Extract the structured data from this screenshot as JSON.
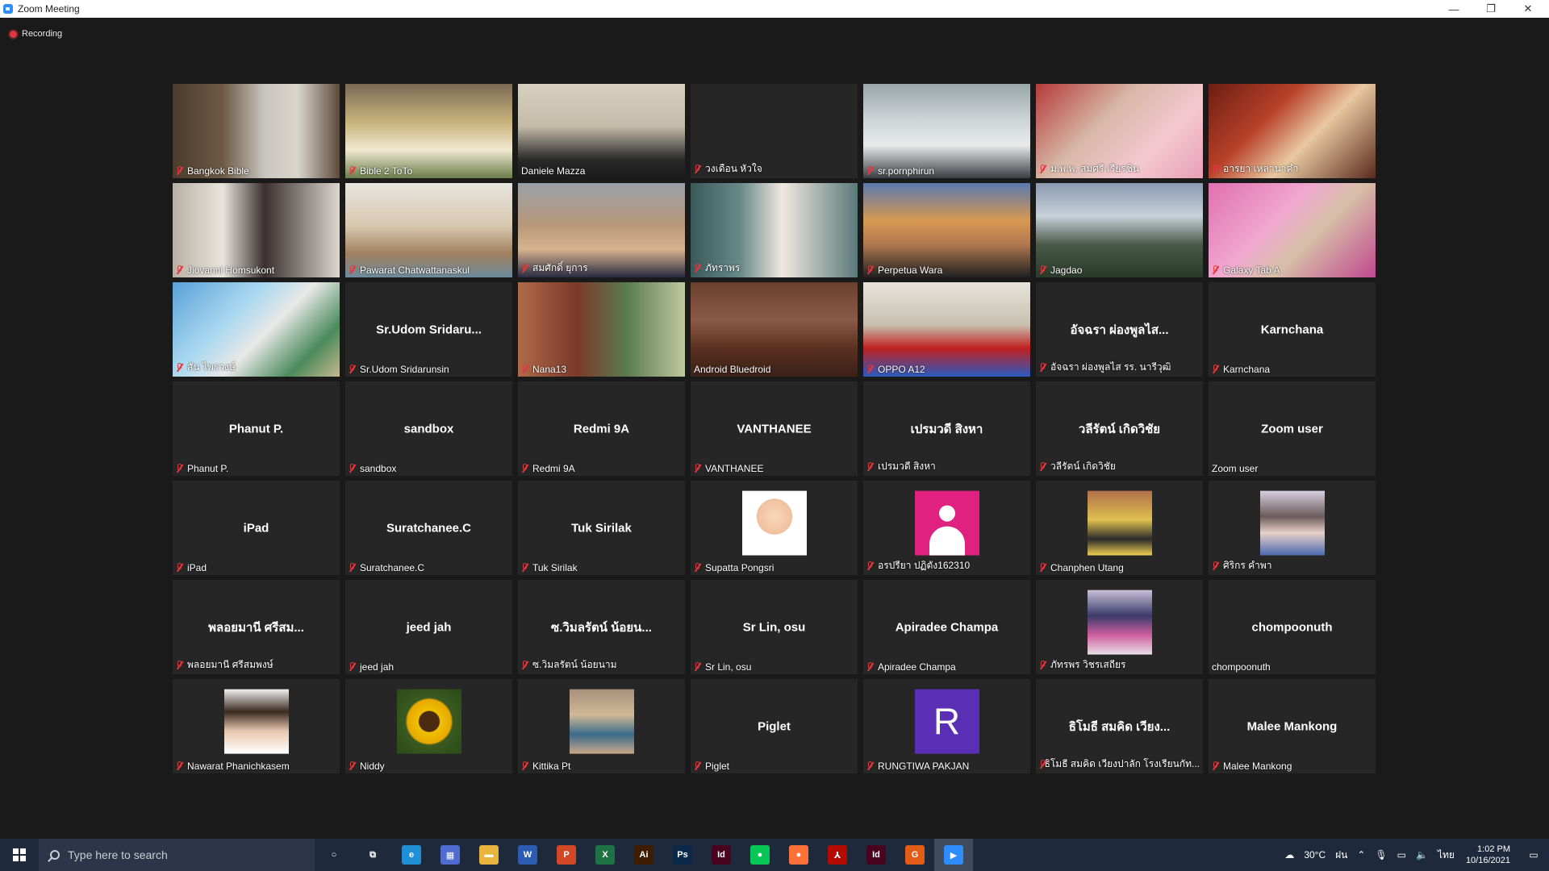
{
  "window": {
    "title": "Zoom Meeting",
    "controls": {
      "minimize": "—",
      "restore": "❐",
      "close": "✕"
    }
  },
  "recording": {
    "label": "Recording"
  },
  "participants": [
    {
      "label": "Bangkok Bible",
      "tile": "",
      "muted": true,
      "video": "p1"
    },
    {
      "label": "Bible 2 ToTo",
      "tile": "",
      "muted": true,
      "video": "p2"
    },
    {
      "label": "Daniele Mazza",
      "tile": "",
      "muted": false,
      "video": "p3",
      "active": true
    },
    {
      "label": "วงเดือน หัวใจ",
      "tile": "",
      "muted": true,
      "video": "dark"
    },
    {
      "label": "sr.pornphirun",
      "tile": "",
      "muted": true,
      "video": "p5"
    },
    {
      "label": "ม.พ.พ. สมศรี เรียรชิน",
      "tile": "",
      "muted": true,
      "video": "p6"
    },
    {
      "label": "อารยา เหลานาคำ",
      "tile": "",
      "muted": true,
      "video": "p7"
    },
    {
      "label": "Jiovanni Homsukont",
      "tile": "",
      "muted": true,
      "video": "p8"
    },
    {
      "label": "Pawarat Chatwattanaskul",
      "tile": "",
      "muted": true,
      "video": "p9"
    },
    {
      "label": "สมศักดิ์ ยุการ",
      "tile": "",
      "muted": true,
      "video": "p10"
    },
    {
      "label": "ภัทราพร",
      "tile": "",
      "muted": true,
      "video": "p11"
    },
    {
      "label": "Perpetua Wara",
      "tile": "",
      "muted": true,
      "video": "p12"
    },
    {
      "label": "Jagdao",
      "tile": "",
      "muted": true,
      "video": "p13"
    },
    {
      "label": "Galaxy Tab A",
      "tile": "",
      "muted": true,
      "video": "p14"
    },
    {
      "label": "สัน ไพรวงษ์",
      "tile": "",
      "muted": true,
      "video": "p15"
    },
    {
      "label": "Sr.Udom Sridarunsin",
      "tile": "Sr.Udom  Sridaru...",
      "muted": true,
      "video": "none"
    },
    {
      "label": "Nana13",
      "tile": "",
      "muted": true,
      "video": "p17"
    },
    {
      "label": "Android Bluedroid",
      "tile": "",
      "muted": false,
      "video": "p18"
    },
    {
      "label": "OPPO A12",
      "tile": "",
      "muted": true,
      "video": "p19"
    },
    {
      "label": "อัจฉรา ผ่องพูลไส รร. นารีวุฒิ",
      "tile": "อัจฉรา ผ่องพูลไส...",
      "muted": true,
      "video": "none"
    },
    {
      "label": "Karnchana",
      "tile": "Karnchana",
      "muted": true,
      "video": "none"
    },
    {
      "label": "Phanut P.",
      "tile": "Phanut P.",
      "muted": true,
      "video": "none"
    },
    {
      "label": "sandbox",
      "tile": "sandbox",
      "muted": true,
      "video": "none"
    },
    {
      "label": "Redmi 9A",
      "tile": "Redmi 9A",
      "muted": true,
      "video": "none"
    },
    {
      "label": "VANTHANEE",
      "tile": "VANTHANEE",
      "muted": true,
      "video": "none"
    },
    {
      "label": "เปรมวดี สิงหา",
      "tile": "เปรมวดี สิงหา",
      "muted": true,
      "video": "none"
    },
    {
      "label": "วลีรัตน์ เกิดวิชัย",
      "tile": "วลีรัตน์ เกิดวิชัย",
      "muted": true,
      "video": "none"
    },
    {
      "label": "Zoom user",
      "tile": "Zoom user",
      "muted": false,
      "video": "none"
    },
    {
      "label": "iPad",
      "tile": "iPad",
      "muted": true,
      "video": "none"
    },
    {
      "label": "Suratchanee.C",
      "tile": "Suratchanee.C",
      "muted": true,
      "video": "none"
    },
    {
      "label": "Tuk Sirilak",
      "tile": "Tuk Sirilak",
      "muted": true,
      "video": "none"
    },
    {
      "label": "Supatta Pongsri",
      "tile": "",
      "muted": true,
      "video": "pic-angel"
    },
    {
      "label": "อรปรียา ปฏิตัง162310",
      "tile": "",
      "muted": true,
      "video": "pic-default"
    },
    {
      "label": "Chanphen Utang",
      "tile": "",
      "muted": true,
      "video": "pic-group"
    },
    {
      "label": "ศิริกร คำพา",
      "tile": "",
      "muted": true,
      "video": "pic-kids"
    },
    {
      "label": "พลอยมานี ศรีสมพงษ์",
      "tile": "พลอยมานี ศรีสม...",
      "muted": true,
      "video": "none"
    },
    {
      "label": "jeed jah",
      "tile": "jeed jah",
      "muted": true,
      "video": "none"
    },
    {
      "label": "ซ.วิมลรัตน์ น้อยนาม",
      "tile": "ซ.วิมลรัตน์ น้อยน...",
      "muted": true,
      "video": "none"
    },
    {
      "label": "Sr Lin, osu",
      "tile": "Sr Lin, osu",
      "muted": true,
      "video": "none"
    },
    {
      "label": "Apiradee Champa",
      "tile": "Apiradee Champa",
      "muted": true,
      "video": "none"
    },
    {
      "label": "ภัทรพร วิชรเสถียร",
      "tile": "",
      "muted": true,
      "video": "pic-flowers"
    },
    {
      "label": "chompoonuth",
      "tile": "chompoonuth",
      "muted": false,
      "video": "none"
    },
    {
      "label": "Nawarat Phanichkasem",
      "tile": "",
      "muted": true,
      "video": "pic-woman"
    },
    {
      "label": "Niddy",
      "tile": "",
      "muted": true,
      "video": "pic-sunflower"
    },
    {
      "label": "Kittika Pt",
      "tile": "",
      "muted": true,
      "video": "pic-girl"
    },
    {
      "label": "Piglet",
      "tile": "Piglet",
      "muted": true,
      "video": "none"
    },
    {
      "label": "RUNGTIWA PAKJAN",
      "tile": "",
      "muted": true,
      "video": "pic-r",
      "initial": "R"
    },
    {
      "label": "ธิโมธี สมคิด เวียงปาลัก โรงเรียนกัท...",
      "tile": "ธิโมธี สมคิด เวียง...",
      "muted": true,
      "video": "none"
    },
    {
      "label": "Malee Mankong",
      "tile": "Malee Mankong",
      "muted": true,
      "video": "none"
    }
  ],
  "taskbar": {
    "search_placeholder": "Type here to search",
    "apps": [
      {
        "name": "cortana-icon",
        "glyph": "○",
        "color": "transparent"
      },
      {
        "name": "task-view-icon",
        "glyph": "⧉",
        "color": "transparent"
      },
      {
        "name": "edge-icon",
        "glyph": "e",
        "color": "#1f8fd6"
      },
      {
        "name": "calculator-icon",
        "glyph": "▦",
        "color": "#4f6bd0"
      },
      {
        "name": "file-explorer-icon",
        "glyph": "▬",
        "color": "#e9b43c"
      },
      {
        "name": "word-icon",
        "glyph": "W",
        "color": "#2b5cb1"
      },
      {
        "name": "powerpoint-icon",
        "glyph": "P",
        "color": "#d24726"
      },
      {
        "name": "excel-icon",
        "glyph": "X",
        "color": "#1f7244"
      },
      {
        "name": "illustrator-icon",
        "glyph": "Ai",
        "color": "#3d1c00"
      },
      {
        "name": "photoshop-icon",
        "glyph": "Ps",
        "color": "#0b2a49"
      },
      {
        "name": "indesign-icon",
        "glyph": "Id",
        "color": "#49021f"
      },
      {
        "name": "line-icon",
        "glyph": "●",
        "color": "#06c755"
      },
      {
        "name": "firefox-icon",
        "glyph": "●",
        "color": "#ff7139"
      },
      {
        "name": "acrobat-icon",
        "glyph": "⅄",
        "color": "#b30b00"
      },
      {
        "name": "indesign2-icon",
        "glyph": "Id",
        "color": "#49021f"
      },
      {
        "name": "g-app-icon",
        "glyph": "G",
        "color": "#e25c16"
      },
      {
        "name": "zoom-icon",
        "glyph": "▶",
        "color": "#2d8cff"
      }
    ],
    "weather": "30°C",
    "tray_extra": "ฝน",
    "lang": "ไทย",
    "time": "1:02 PM",
    "date": "10/16/2021"
  }
}
